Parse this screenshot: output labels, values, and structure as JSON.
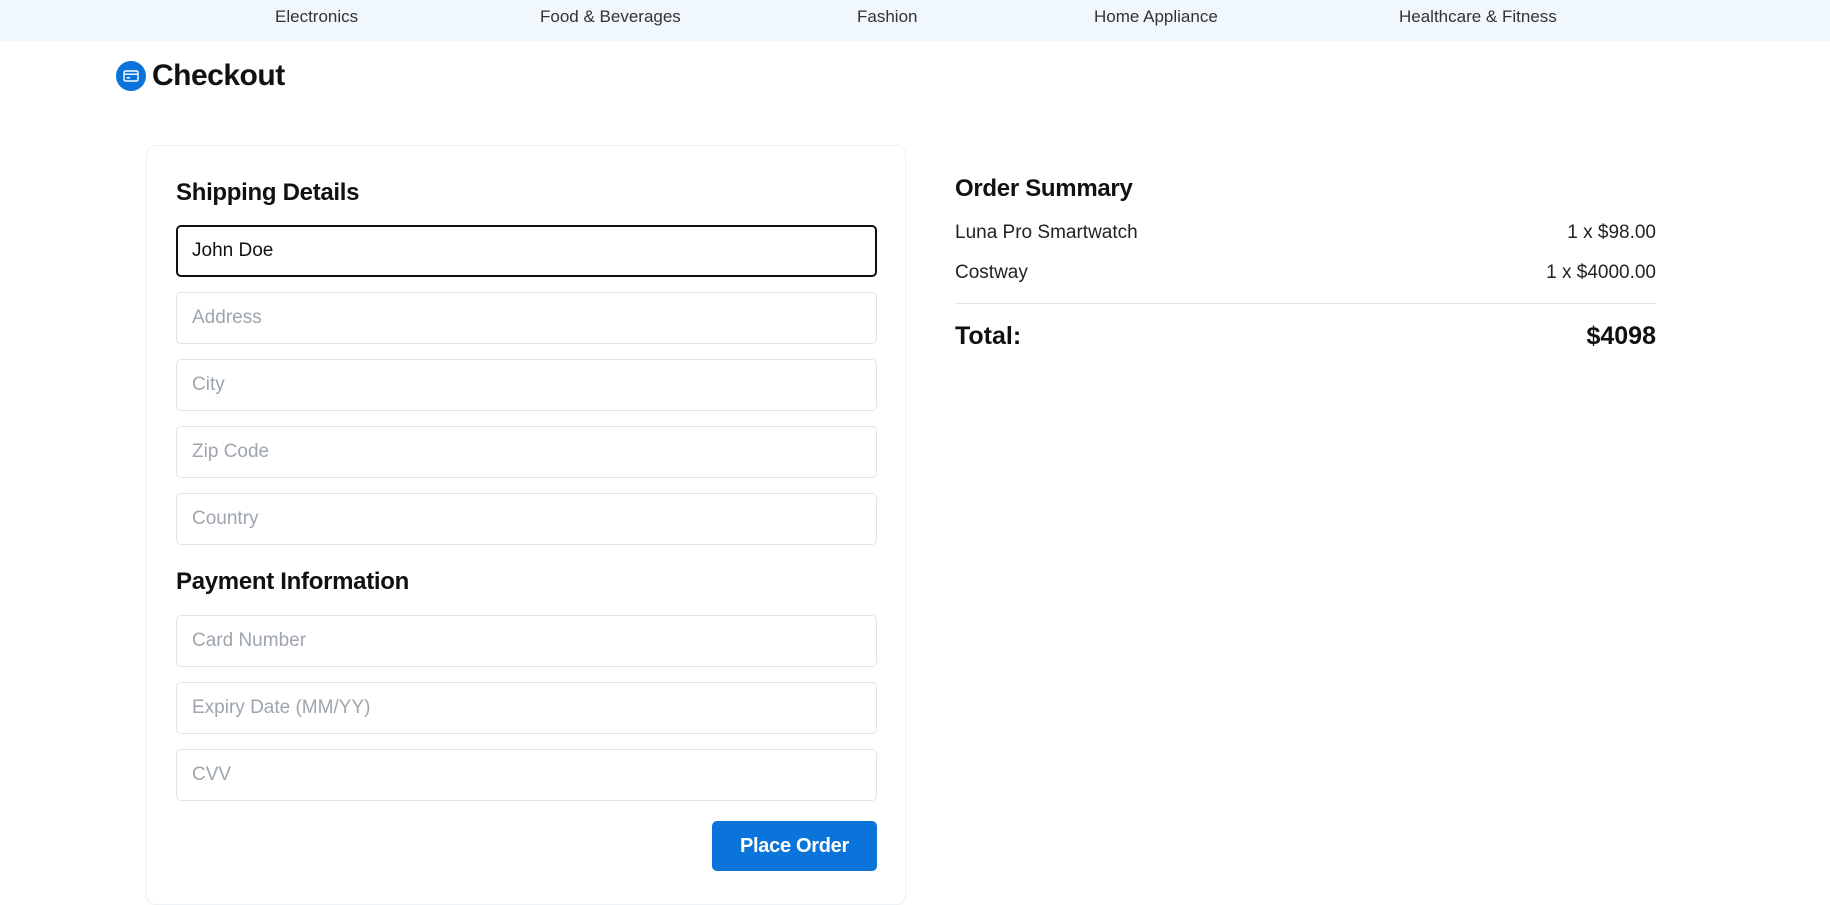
{
  "nav": {
    "items": [
      "Electronics",
      "Food & Beverages",
      "Fashion",
      "Home Appliance",
      "Healthcare & Fitness"
    ]
  },
  "header": {
    "title": "Checkout",
    "icon": "credit-card-icon"
  },
  "shipping": {
    "title": "Shipping Details",
    "name_value": "John Doe",
    "address_placeholder": "Address",
    "city_placeholder": "City",
    "zip_placeholder": "Zip Code",
    "country_placeholder": "Country"
  },
  "payment": {
    "title": "Payment Information",
    "card_placeholder": "Card Number",
    "expiry_placeholder": "Expiry Date (MM/YY)",
    "cvv_placeholder": "CVV",
    "submit_label": "Place Order"
  },
  "summary": {
    "title": "Order Summary",
    "items": [
      {
        "name": "Luna Pro Smartwatch",
        "qty_price": "1 x $98.00"
      },
      {
        "name": "Costway",
        "qty_price": "1 x $4000.00"
      }
    ],
    "total_label": "Total:",
    "total_value": "$4098"
  },
  "colors": {
    "accent": "#0a74da",
    "nav_bg": "#f0f7fd",
    "placeholder": "#9ea5ae"
  }
}
